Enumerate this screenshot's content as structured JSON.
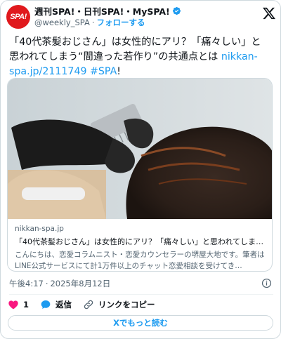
{
  "account": {
    "avatar_text": "SPA!",
    "display_name": "週刊SPA!・日刊SPA!・MySPA!",
    "handle": "@weekly_SPA",
    "separator": "·",
    "follow_label": "フォローする"
  },
  "tweet": {
    "text_line1": "「40代茶髪おじさん」は女性的にアリ？「痛々しい」と",
    "text_line2": "思われてしまう“間違った若作り”の共通点とは ",
    "link_text": "nikkan-spa.jp/2111749",
    "hashtag": "#SPA",
    "trailing": "!"
  },
  "card": {
    "domain": "nikkan-spa.jp",
    "title": "「40代茶髪おじさん」は女性的にアリ？「痛々しい」と思われてしま…",
    "description": "こんにちは、恋愛コラムニスト・恋愛カウンセラーの堺屋大地です。筆者はLINE公式サービスにて計1万件以上のチャット恋愛相談を受けてき…"
  },
  "meta": {
    "time": "午後4:17",
    "separator": "·",
    "date": "2025年8月12日"
  },
  "actions": {
    "like_count": "1",
    "reply_label": "返信",
    "copy_link_label": "リンクをコピー"
  },
  "more_button_label": "Xでもっと読む",
  "colors": {
    "brand_red": "#e0191d",
    "accent_blue": "#1d9bf0",
    "like_pink": "#f91880",
    "secondary_text": "#536471"
  }
}
